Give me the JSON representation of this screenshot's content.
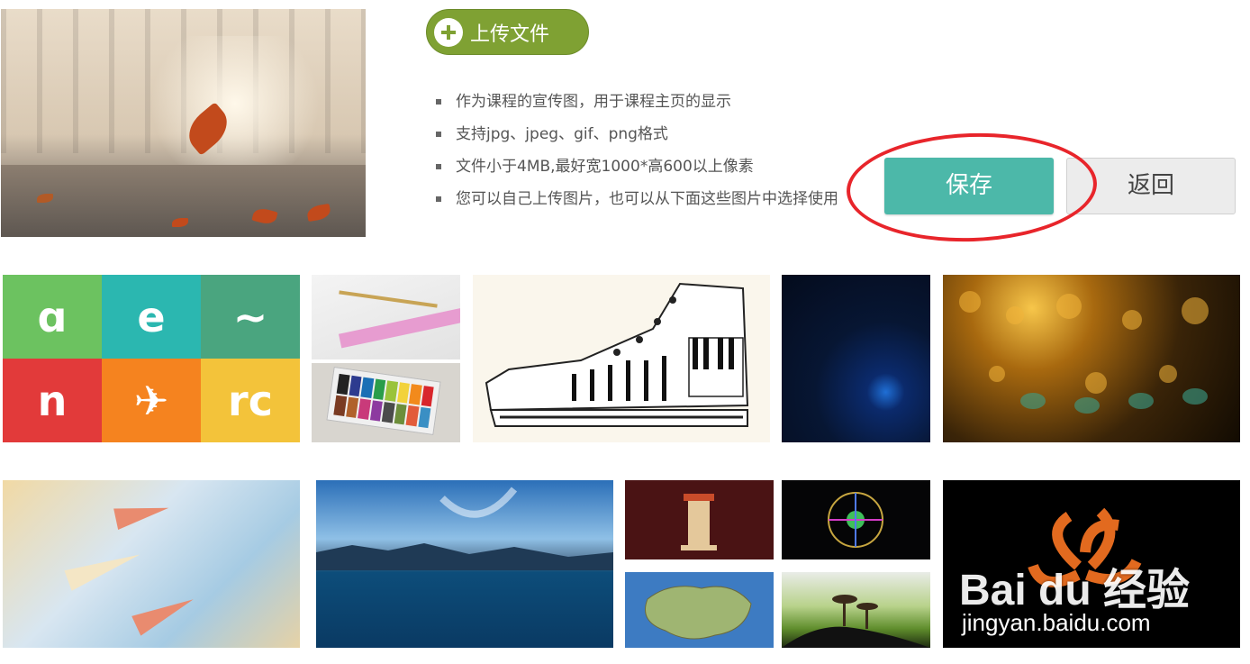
{
  "upload": {
    "label": "上传文件",
    "icon": "plus-circle-icon",
    "color": "#7fa133"
  },
  "tips": [
    "作为课程的宣传图，用于课程主页的显示",
    "支持jpg、jpeg、gif、png格式",
    "文件小于4MB,最好宽1000*高600以上像素",
    "您可以自己上传图片，也可以从下面这些图片中选择使用"
  ],
  "actions": {
    "save_label": "保存",
    "back_label": "返回",
    "save_color": "#4cb8a9",
    "highlight_color": "#e8252b"
  },
  "preview": {
    "alt": "autumn-leaf-bridge-image"
  },
  "gallery": [
    {
      "name": "app-icons-grid",
      "tiles": [
        "ɑ",
        "e",
        "~",
        "n",
        "✈",
        "rc"
      ]
    },
    {
      "name": "ruler-pencil-image"
    },
    {
      "name": "watercolor-paint-box-image"
    },
    {
      "name": "piano-sneaker-image"
    },
    {
      "name": "blue-network-image"
    },
    {
      "name": "golden-bokeh-image"
    },
    {
      "name": "paper-planes-image"
    },
    {
      "name": "mountain-lake-image"
    },
    {
      "name": "tower-illustration-image"
    },
    {
      "name": "colorful-wheel-image"
    },
    {
      "name": "fantasy-map-image"
    },
    {
      "name": "mushroom-image"
    },
    {
      "name": "logo-image"
    }
  ],
  "watermark": {
    "brand": "Bai du 经验",
    "url": "jingyan.baidu.com"
  }
}
